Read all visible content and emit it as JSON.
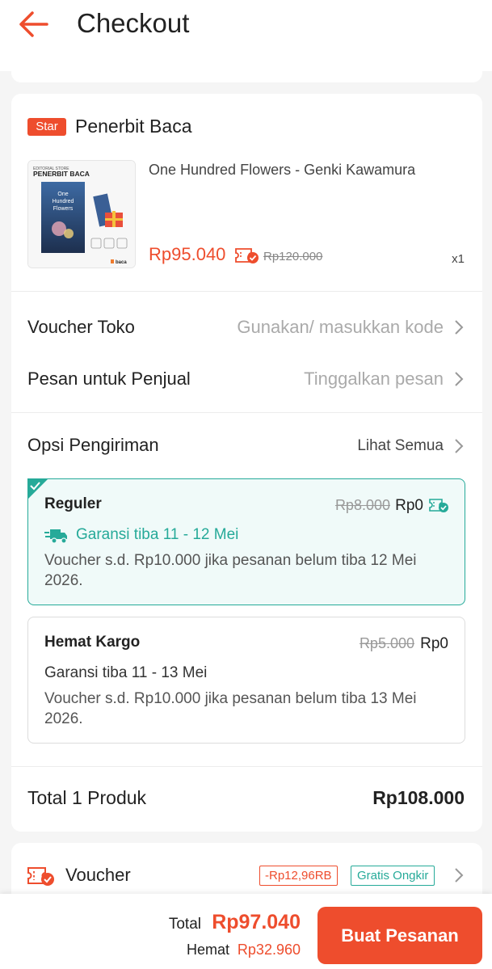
{
  "header": {
    "title": "Checkout",
    "back_icon": "arrow-left-icon"
  },
  "colors": {
    "accent": "#ee4d2d",
    "success": "#26aa99"
  },
  "shop": {
    "badge": "Star",
    "name": "Penerbit Baca"
  },
  "product": {
    "name": "One Hundred Flowers - Genki Kawamura",
    "price": "Rp95.040",
    "old_price": "Rp120.000",
    "qty": "x1",
    "cover": {
      "brand_small": "EDITORIAL STORE",
      "brand": "PENERBIT BACA",
      "book_title_1": "One",
      "book_title_2": "Hundred",
      "book_title_3": "Flowers",
      "logo": "baca"
    }
  },
  "rows": {
    "voucher_toko_label": "Voucher Toko",
    "voucher_toko_value": "Gunakan/ masukkan kode",
    "pesan_label": "Pesan untuk Penjual",
    "pesan_value": "Tinggalkan pesan"
  },
  "shipping": {
    "label": "Opsi Pengiriman",
    "see_all": "Lihat Semua",
    "options": [
      {
        "name": "Reguler",
        "old_price": "Rp8.000",
        "price": "Rp0",
        "guarantee": "Garansi tiba 11 - 12 Mei",
        "note": "Voucher s.d.  Rp10.000 jika pesanan belum tiba 12 Mei 2026.",
        "selected": true
      },
      {
        "name": "Hemat Kargo",
        "old_price": "Rp5.000",
        "price": "Rp0",
        "guarantee": "Garansi tiba 11 - 13 Mei",
        "note": "Voucher s.d.  Rp10.000 jika pesanan belum tiba 13 Mei 2026.",
        "selected": false
      }
    ]
  },
  "total": {
    "label": "Total 1 Produk",
    "value": "Rp108.000"
  },
  "voucher": {
    "label": "Voucher",
    "discount_tag": "-Rp12,96RB",
    "free_tag": "Gratis Ongkir"
  },
  "bottom": {
    "total_label": "Total",
    "total_value": "Rp97.040",
    "save_label": "Hemat",
    "save_value": "Rp32.960",
    "order_button": "Buat Pesanan"
  }
}
